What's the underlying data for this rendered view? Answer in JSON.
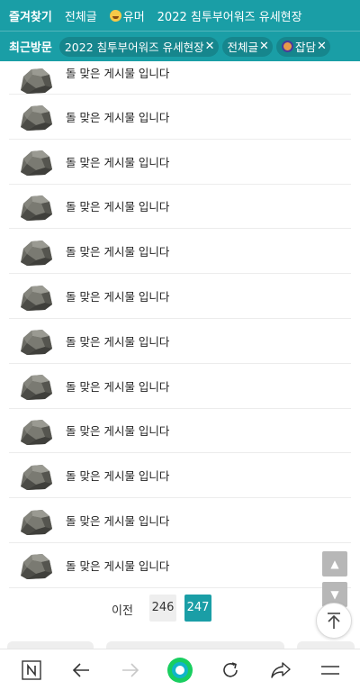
{
  "favorites": {
    "label": "즐겨찾기",
    "items": [
      {
        "label": "전체글",
        "icon": "none"
      },
      {
        "label": "유머",
        "icon": "grinning-face-emoji"
      },
      {
        "label": "2022 침투부어워즈 유세현장",
        "icon": "none"
      }
    ]
  },
  "recent": {
    "label": "최근방문",
    "chips": [
      {
        "label": "2022 침투부어워즈 유세현장",
        "icon": "none",
        "close": "✕"
      },
      {
        "label": "전체글",
        "icon": "none",
        "close": "✕"
      },
      {
        "label": "잡담",
        "icon": "anime-avatar-emoji",
        "close": "✕"
      }
    ]
  },
  "posts": [
    {
      "title": "돌 맞은 게시물 입니다",
      "thumb": "rock-image"
    },
    {
      "title": "돌 맞은 게시물 입니다",
      "thumb": "rock-image"
    },
    {
      "title": "돌 맞은 게시물 입니다",
      "thumb": "rock-image"
    },
    {
      "title": "돌 맞은 게시물 입니다",
      "thumb": "rock-image"
    },
    {
      "title": "돌 맞은 게시물 입니다",
      "thumb": "rock-image"
    },
    {
      "title": "돌 맞은 게시물 입니다",
      "thumb": "rock-image"
    },
    {
      "title": "돌 맞은 게시물 입니다",
      "thumb": "rock-image"
    },
    {
      "title": "돌 맞은 게시물 입니다",
      "thumb": "rock-image"
    },
    {
      "title": "돌 맞은 게시물 입니다",
      "thumb": "rock-image"
    },
    {
      "title": "돌 맞은 게시물 입니다",
      "thumb": "rock-image"
    },
    {
      "title": "돌 맞은 게시물 입니다",
      "thumb": "rock-image"
    },
    {
      "title": "돌 맞은 게시물 입니다",
      "thumb": "rock-image"
    }
  ],
  "pagination": {
    "prev_label": "이전",
    "pages": [
      "246",
      "247"
    ],
    "current": "247"
  },
  "scroll_controls": {
    "up": "▲",
    "down": "▼",
    "top_icon": "arrow-to-top-icon"
  },
  "bottom_nav": {
    "icons": [
      "naver-n-icon",
      "back-arrow-icon",
      "forward-arrow-icon",
      "green-dot-icon",
      "refresh-icon",
      "share-icon",
      "menu-icon"
    ]
  },
  "colors": {
    "header": "#1a9ea6",
    "current_page": "#1a9ea6",
    "green_dot": "#19ce60"
  }
}
